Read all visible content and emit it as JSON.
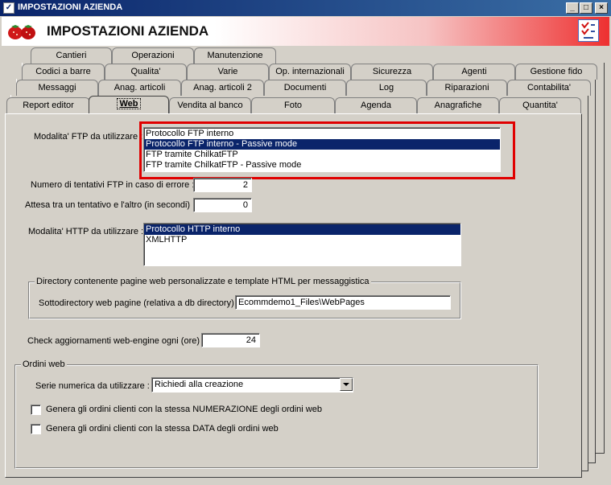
{
  "window": {
    "title": "IMPOSTAZIONI AZIENDA",
    "minimize_label": "_",
    "maximize_label": "□",
    "close_label": "×"
  },
  "header": {
    "title": "IMPOSTAZIONI AZIENDA"
  },
  "tabs": {
    "row1": [
      "Cantieri",
      "Operazioni",
      "Manutenzione"
    ],
    "row2": [
      "Codici a barre",
      "Qualita'",
      "Varie",
      "Op. internazionali",
      "Sicurezza",
      "Agenti",
      "Gestione fido"
    ],
    "row3": [
      "Messaggi",
      "Anag. articoli",
      "Anag. articoli 2",
      "Documenti",
      "Log",
      "Riparazioni",
      "Contabilita'"
    ],
    "row4": [
      "Report editor",
      "Web",
      "Vendita al banco",
      "Foto",
      "Agenda",
      "Anagrafiche",
      "Quantita'"
    ],
    "active": "Web"
  },
  "web": {
    "ftp_label": "Modalita' FTP da utilizzare :",
    "ftp_options": [
      "Protocollo FTP interno",
      "Protocollo FTP interno - Passive mode",
      "FTP tramite ChilkatFTP",
      "FTP tramite ChilkatFTP - Passive mode"
    ],
    "ftp_selected": "Protocollo FTP interno - Passive mode",
    "retries_label": "Numero di tentativi FTP in caso di errore :",
    "retries_value": "2",
    "wait_label": "Attesa tra un tentativo e l'altro (in secondi) :",
    "wait_value": "0",
    "http_label": "Modalita' HTTP da utilizzare :",
    "http_options": [
      "Protocollo HTTP interno",
      "XMLHTTP"
    ],
    "http_selected": "Protocollo HTTP interno",
    "dir_group_title": "Directory contenente pagine web personalizzate e template HTML per messaggistica",
    "subdir_label": "Sottodirectory web pagine (relativa a db directory) :",
    "subdir_value": "Ecommdemo1_Files\\WebPages",
    "check_updates_label": "Check aggiornamenti web-engine ogni (ore) :",
    "check_updates_value": "24"
  },
  "orders": {
    "group_title": "Ordini web",
    "series_label": "Serie numerica da utilizzare :",
    "series_value": "Richiedi alla creazione",
    "same_numbering_label": "Genera gli ordini clienti con la stessa NUMERAZIONE degli ordini web",
    "same_numbering_checked": false,
    "same_date_label": "Genera gli ordini clienti con la stessa DATA degli ordini web",
    "same_date_checked": false
  },
  "colors": {
    "selection": "#0a246a",
    "highlight_border": "#e00000",
    "titlebar": "#0a246a"
  }
}
